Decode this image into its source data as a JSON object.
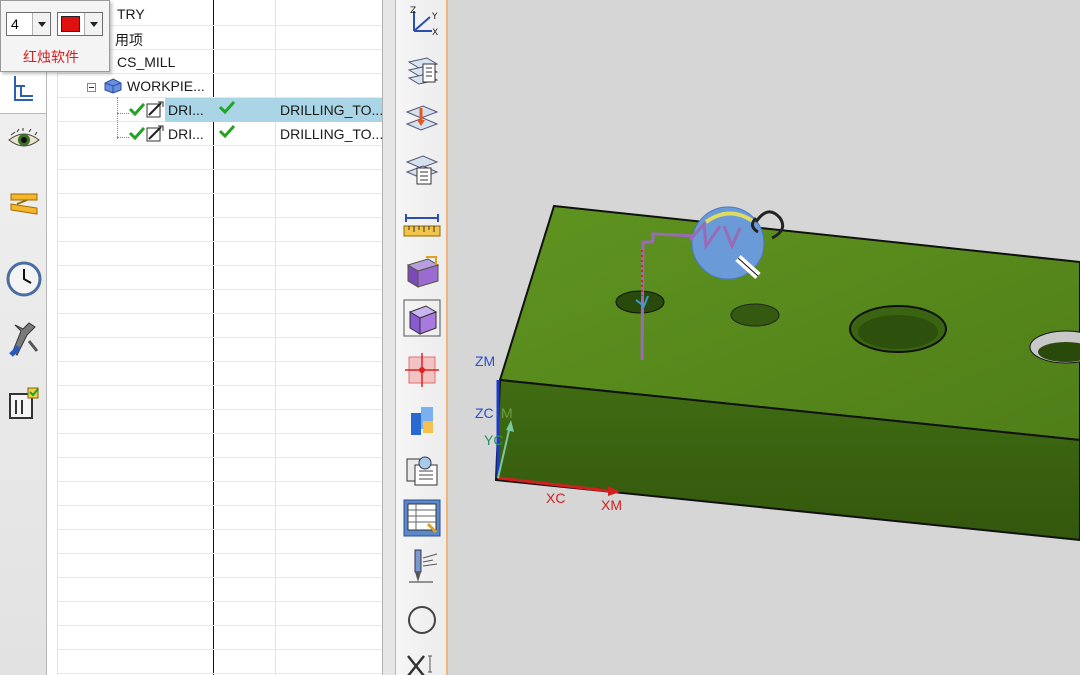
{
  "popup": {
    "number_value": "4",
    "color_value": "#e01010",
    "label": "红烛软件"
  },
  "navigator": {
    "rows": [
      {
        "name": "TRY"
      },
      {
        "name": "用项"
      },
      {
        "name": "CS_MILL"
      },
      {
        "name": "WORKPIE..."
      },
      {
        "name": "DRI...",
        "col3": "DRILLING_TO...",
        "selected": true
      },
      {
        "name": "DRI...",
        "col3": "DRILLING_TO..."
      }
    ]
  },
  "left_strip_icons": [
    "tree-view-icon",
    "eye-icon",
    "layers-icon",
    "clock-icon",
    "tools-icon",
    "machine-icon"
  ],
  "toolbar_icons": [
    "wcs-triad-icon",
    "list-view-icon",
    "cut-plane-icon",
    "copy-layers-icon",
    "measure-ruler-icon",
    "block-purple-icon",
    "box-wireframe-icon",
    "snap-point-icon",
    "color-blocks-icon",
    "process-icon",
    "table-icon",
    "drill-tool-icon",
    "circle-icon",
    "cross-sketch-icon"
  ],
  "viewport": {
    "labels": {
      "zm": "ZM",
      "zc": "ZC",
      "m": "M",
      "yc": "YC",
      "xc": "XC",
      "xm": "XM"
    },
    "colors": {
      "part_top": "#5a8a1e",
      "part_front": "#3f6a12",
      "axis_blue": "#1a3bd0",
      "axis_red": "#d02020",
      "toolpath": "#9a6bb5"
    }
  }
}
